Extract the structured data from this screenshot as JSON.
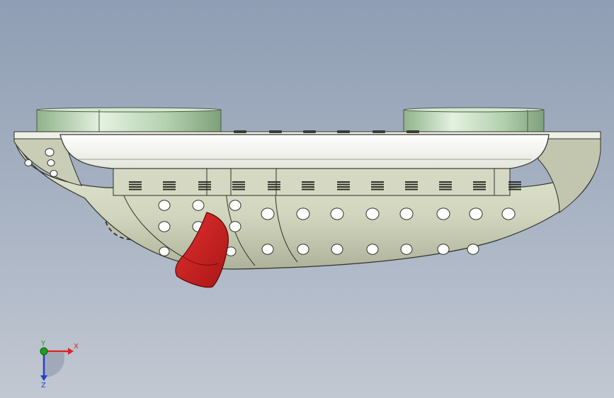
{
  "view": {
    "colors": {
      "background_top": "#8f9eb4",
      "background_bottom": "#c2c8d2",
      "body": "#d8dcc6",
      "body_shadow": "#9ea28c",
      "top_plate": "#f4f5f0",
      "cylinders": "#b8d6b4",
      "red_part": "#cc1f1f",
      "holes": "#ffffff"
    },
    "triad": {
      "x_label": "X",
      "y_label": "Y",
      "z_label": "Z",
      "x_color": "#d8262a",
      "y_color": "#1aa01a",
      "z_color": "#2a3fc8"
    }
  }
}
